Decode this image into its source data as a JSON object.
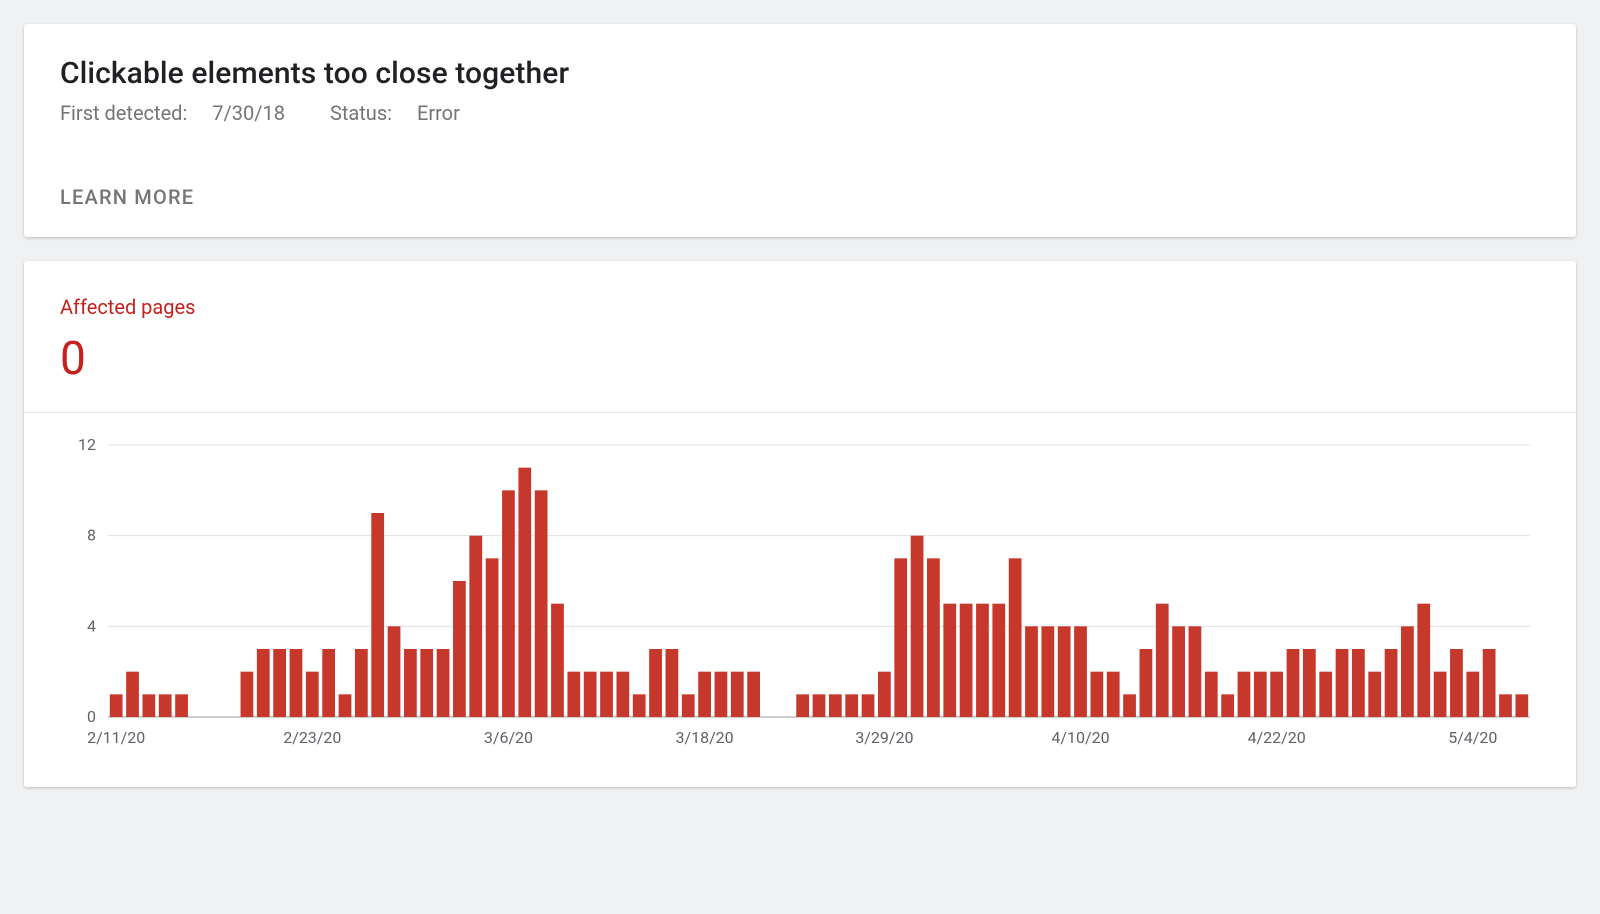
{
  "header": {
    "title": "Clickable elements too close together",
    "first_detected_label": "First detected:",
    "first_detected_value": "7/30/18",
    "status_label": "Status:",
    "status_value": "Error",
    "learn_more": "LEARN MORE"
  },
  "metric": {
    "label": "Affected pages",
    "value": "0"
  },
  "chart_data": {
    "type": "bar",
    "title": "",
    "xlabel": "",
    "ylabel": "",
    "ylim": [
      0,
      12
    ],
    "y_ticks": [
      0,
      4,
      8,
      12
    ],
    "x_tick_labels": [
      "2/11/20",
      "2/23/20",
      "3/6/20",
      "3/18/20",
      "3/29/20",
      "4/10/20",
      "4/22/20",
      "5/4/20"
    ],
    "x_tick_positions": [
      0,
      12,
      24,
      36,
      47,
      59,
      71,
      83
    ],
    "categories": [
      "2/11/20",
      "2/12/20",
      "2/13/20",
      "2/14/20",
      "2/15/20",
      "2/16/20",
      "2/17/20",
      "2/18/20",
      "2/19/20",
      "2/20/20",
      "2/21/20",
      "2/22/20",
      "2/23/20",
      "2/24/20",
      "2/25/20",
      "2/26/20",
      "2/27/20",
      "2/28/20",
      "2/29/20",
      "3/1/20",
      "3/2/20",
      "3/3/20",
      "3/4/20",
      "3/5/20",
      "3/6/20",
      "3/7/20",
      "3/8/20",
      "3/9/20",
      "3/10/20",
      "3/11/20",
      "3/12/20",
      "3/13/20",
      "3/14/20",
      "3/15/20",
      "3/16/20",
      "3/17/20",
      "3/18/20",
      "3/19/20",
      "3/20/20",
      "3/21/20",
      "3/22/20",
      "3/23/20",
      "3/24/20",
      "3/25/20",
      "3/26/20",
      "3/27/20",
      "3/28/20",
      "3/29/20",
      "3/30/20",
      "3/31/20",
      "4/1/20",
      "4/2/20",
      "4/3/20",
      "4/4/20",
      "4/5/20",
      "4/6/20",
      "4/7/20",
      "4/8/20",
      "4/9/20",
      "4/10/20",
      "4/11/20",
      "4/12/20",
      "4/13/20",
      "4/14/20",
      "4/15/20",
      "4/16/20",
      "4/17/20",
      "4/18/20",
      "4/19/20",
      "4/20/20",
      "4/21/20",
      "4/22/20",
      "4/23/20",
      "4/24/20",
      "4/25/20",
      "4/26/20",
      "4/27/20",
      "4/28/20",
      "4/29/20",
      "4/30/20",
      "5/1/20",
      "5/2/20",
      "5/3/20",
      "5/4/20",
      "5/5/20",
      "5/6/20"
    ],
    "values": [
      1,
      2,
      1,
      1,
      1,
      0,
      0,
      0,
      2,
      3,
      3,
      3,
      2,
      3,
      1,
      3,
      9,
      4,
      3,
      3,
      3,
      6,
      8,
      7,
      10,
      11,
      10,
      5,
      2,
      2,
      2,
      2,
      1,
      3,
      3,
      1,
      2,
      2,
      2,
      2,
      0,
      0,
      1,
      1,
      1,
      1,
      1,
      2,
      7,
      8,
      7,
      5,
      5,
      5,
      5,
      7,
      4,
      4,
      4,
      4,
      2,
      2,
      1,
      3,
      5,
      4,
      4,
      2,
      1,
      2,
      2,
      2,
      3,
      3,
      2,
      3,
      3,
      2,
      3,
      4,
      5,
      2,
      3,
      2,
      3,
      1,
      1
    ]
  },
  "colors": {
    "accent": "#c5221f",
    "bar": "#c5382b"
  }
}
